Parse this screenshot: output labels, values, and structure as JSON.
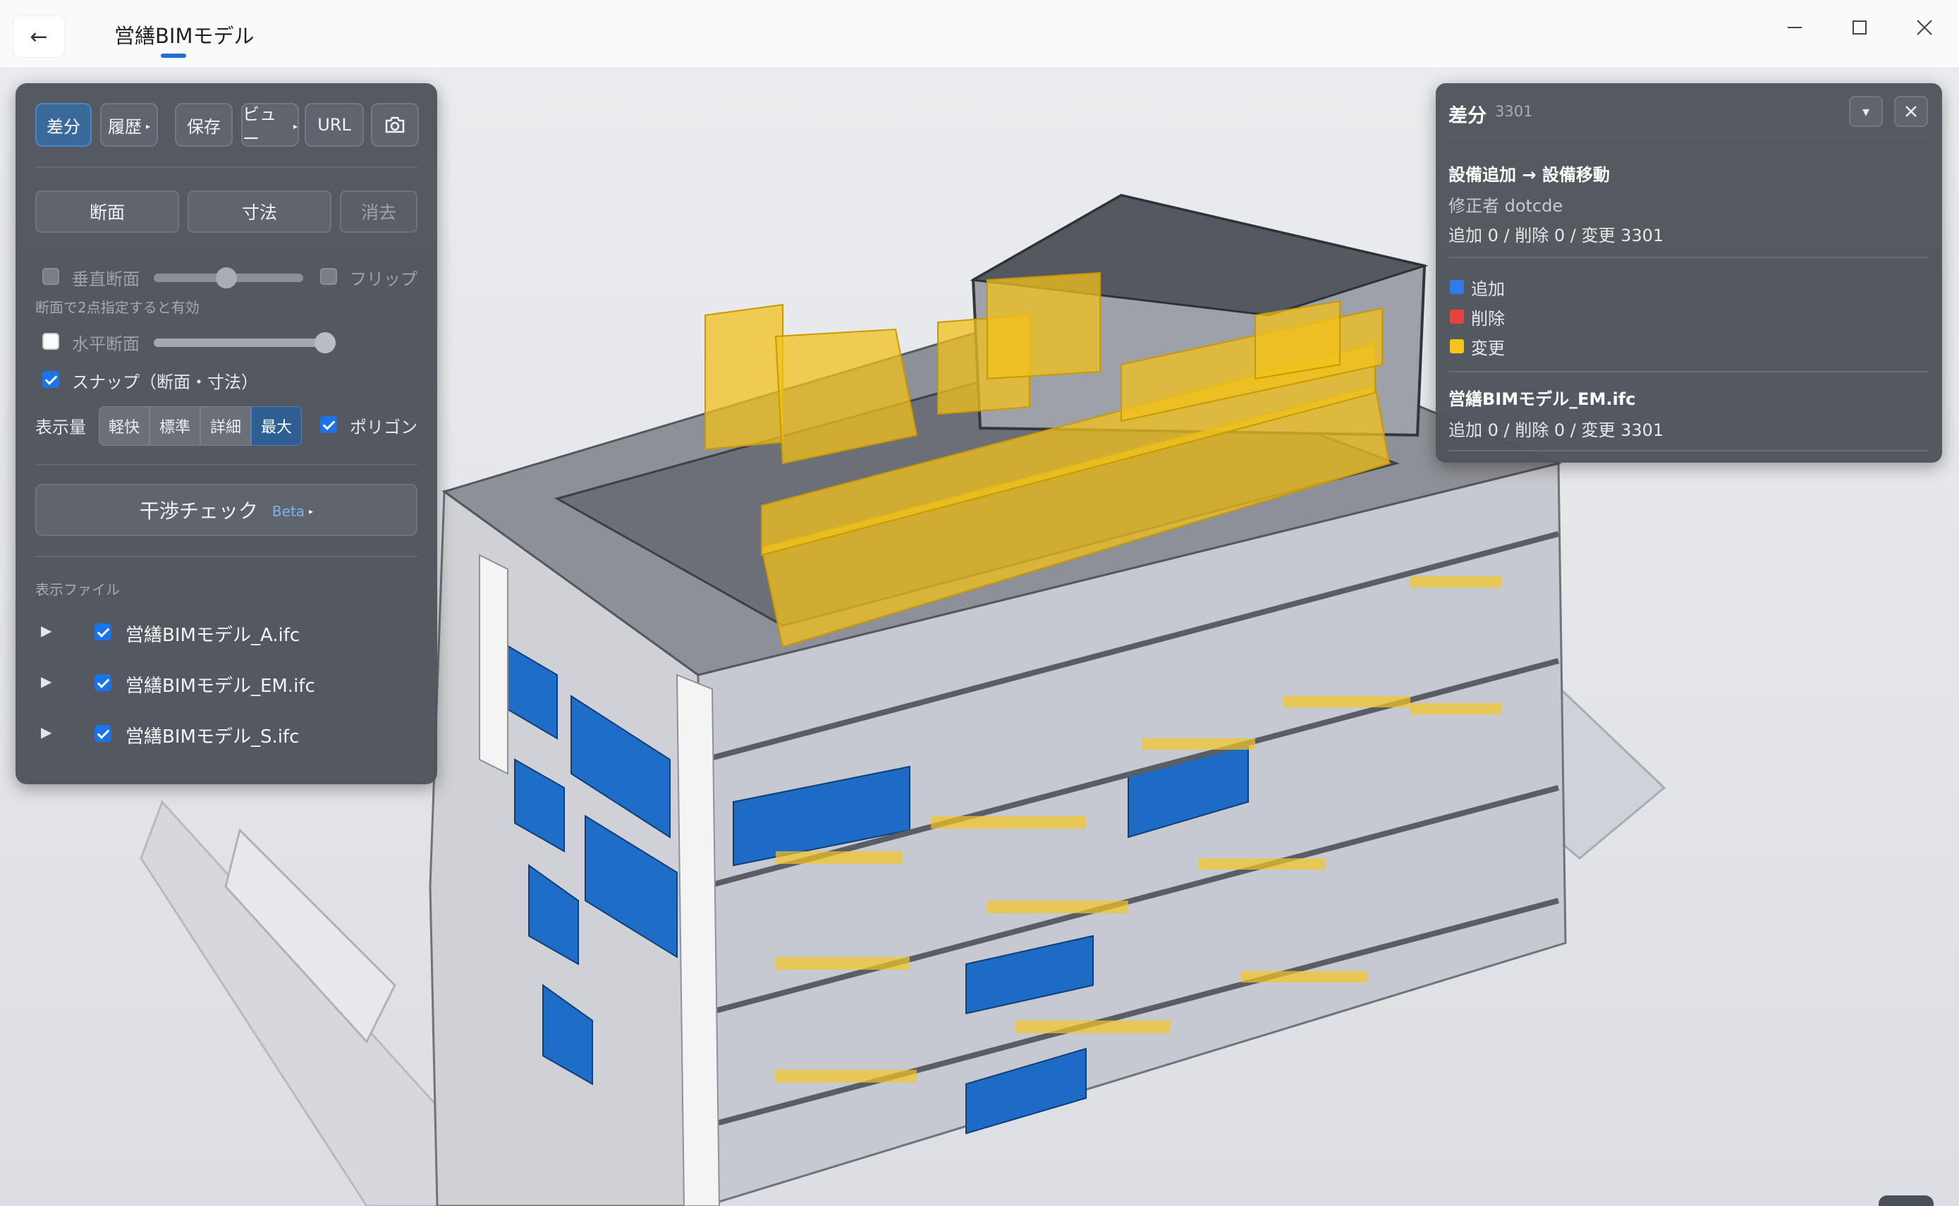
{
  "window": {
    "back_label": "←",
    "title": "営繕BIMモデル"
  },
  "toolbar": {
    "diff_label": "差分",
    "history_label": "履歴",
    "save_label": "保存",
    "view_label": "ビュー",
    "url_label": "URL"
  },
  "tools": {
    "section_label": "断面",
    "dimension_label": "寸法",
    "clear_label": "消去"
  },
  "section": {
    "vertical_label": "垂直断面",
    "vertical_checked": false,
    "vertical_level": 0.5,
    "flip_label": "フリップ",
    "flip_checked": false,
    "hint": "断面で2点指定すると有効",
    "horizontal_label": "水平断面",
    "horizontal_checked": false,
    "horizontal_level": 1.0,
    "snap_label": "スナップ（断面・寸法）",
    "snap_checked": true
  },
  "display": {
    "amount_label": "表示量",
    "levels": [
      "軽快",
      "標準",
      "詳細",
      "最大"
    ],
    "selected_level": "最大",
    "polygon_label": "ポリゴン",
    "polygon_checked": true
  },
  "clash": {
    "label": "干渉チェック",
    "badge": "Beta"
  },
  "files": {
    "heading": "表示ファイル",
    "items": [
      {
        "name": "営繕BIMモデル_A.ifc",
        "checked": true
      },
      {
        "name": "営繕BIMモデル_EM.ifc",
        "checked": true
      },
      {
        "name": "営繕BIMモデル_S.ifc",
        "checked": true
      }
    ]
  },
  "diff_panel": {
    "title": "差分",
    "count": "3301",
    "change_title": "設備追加 → 設備移動",
    "editor": "修正者 dotcde",
    "summary": "追加 0 / 削除 0 / 変更 3301",
    "legend": [
      {
        "label": "追加",
        "color": "#2f7bea"
      },
      {
        "label": "削除",
        "color": "#e5433b"
      },
      {
        "label": "変更",
        "color": "#f5c518"
      }
    ],
    "file_name": "営繕BIMモデル_EM.ifc",
    "file_summary": "追加 0 / 削除 0 / 変更 3301"
  },
  "colors": {
    "accent": "#1f6fd1",
    "panel": "#4e525a",
    "changed": "#f5c518"
  },
  "icons": {
    "camera": "camera-icon",
    "fullscreen": "fullscreen-icon",
    "close": "close-icon",
    "collapse": "caret-down-icon"
  }
}
